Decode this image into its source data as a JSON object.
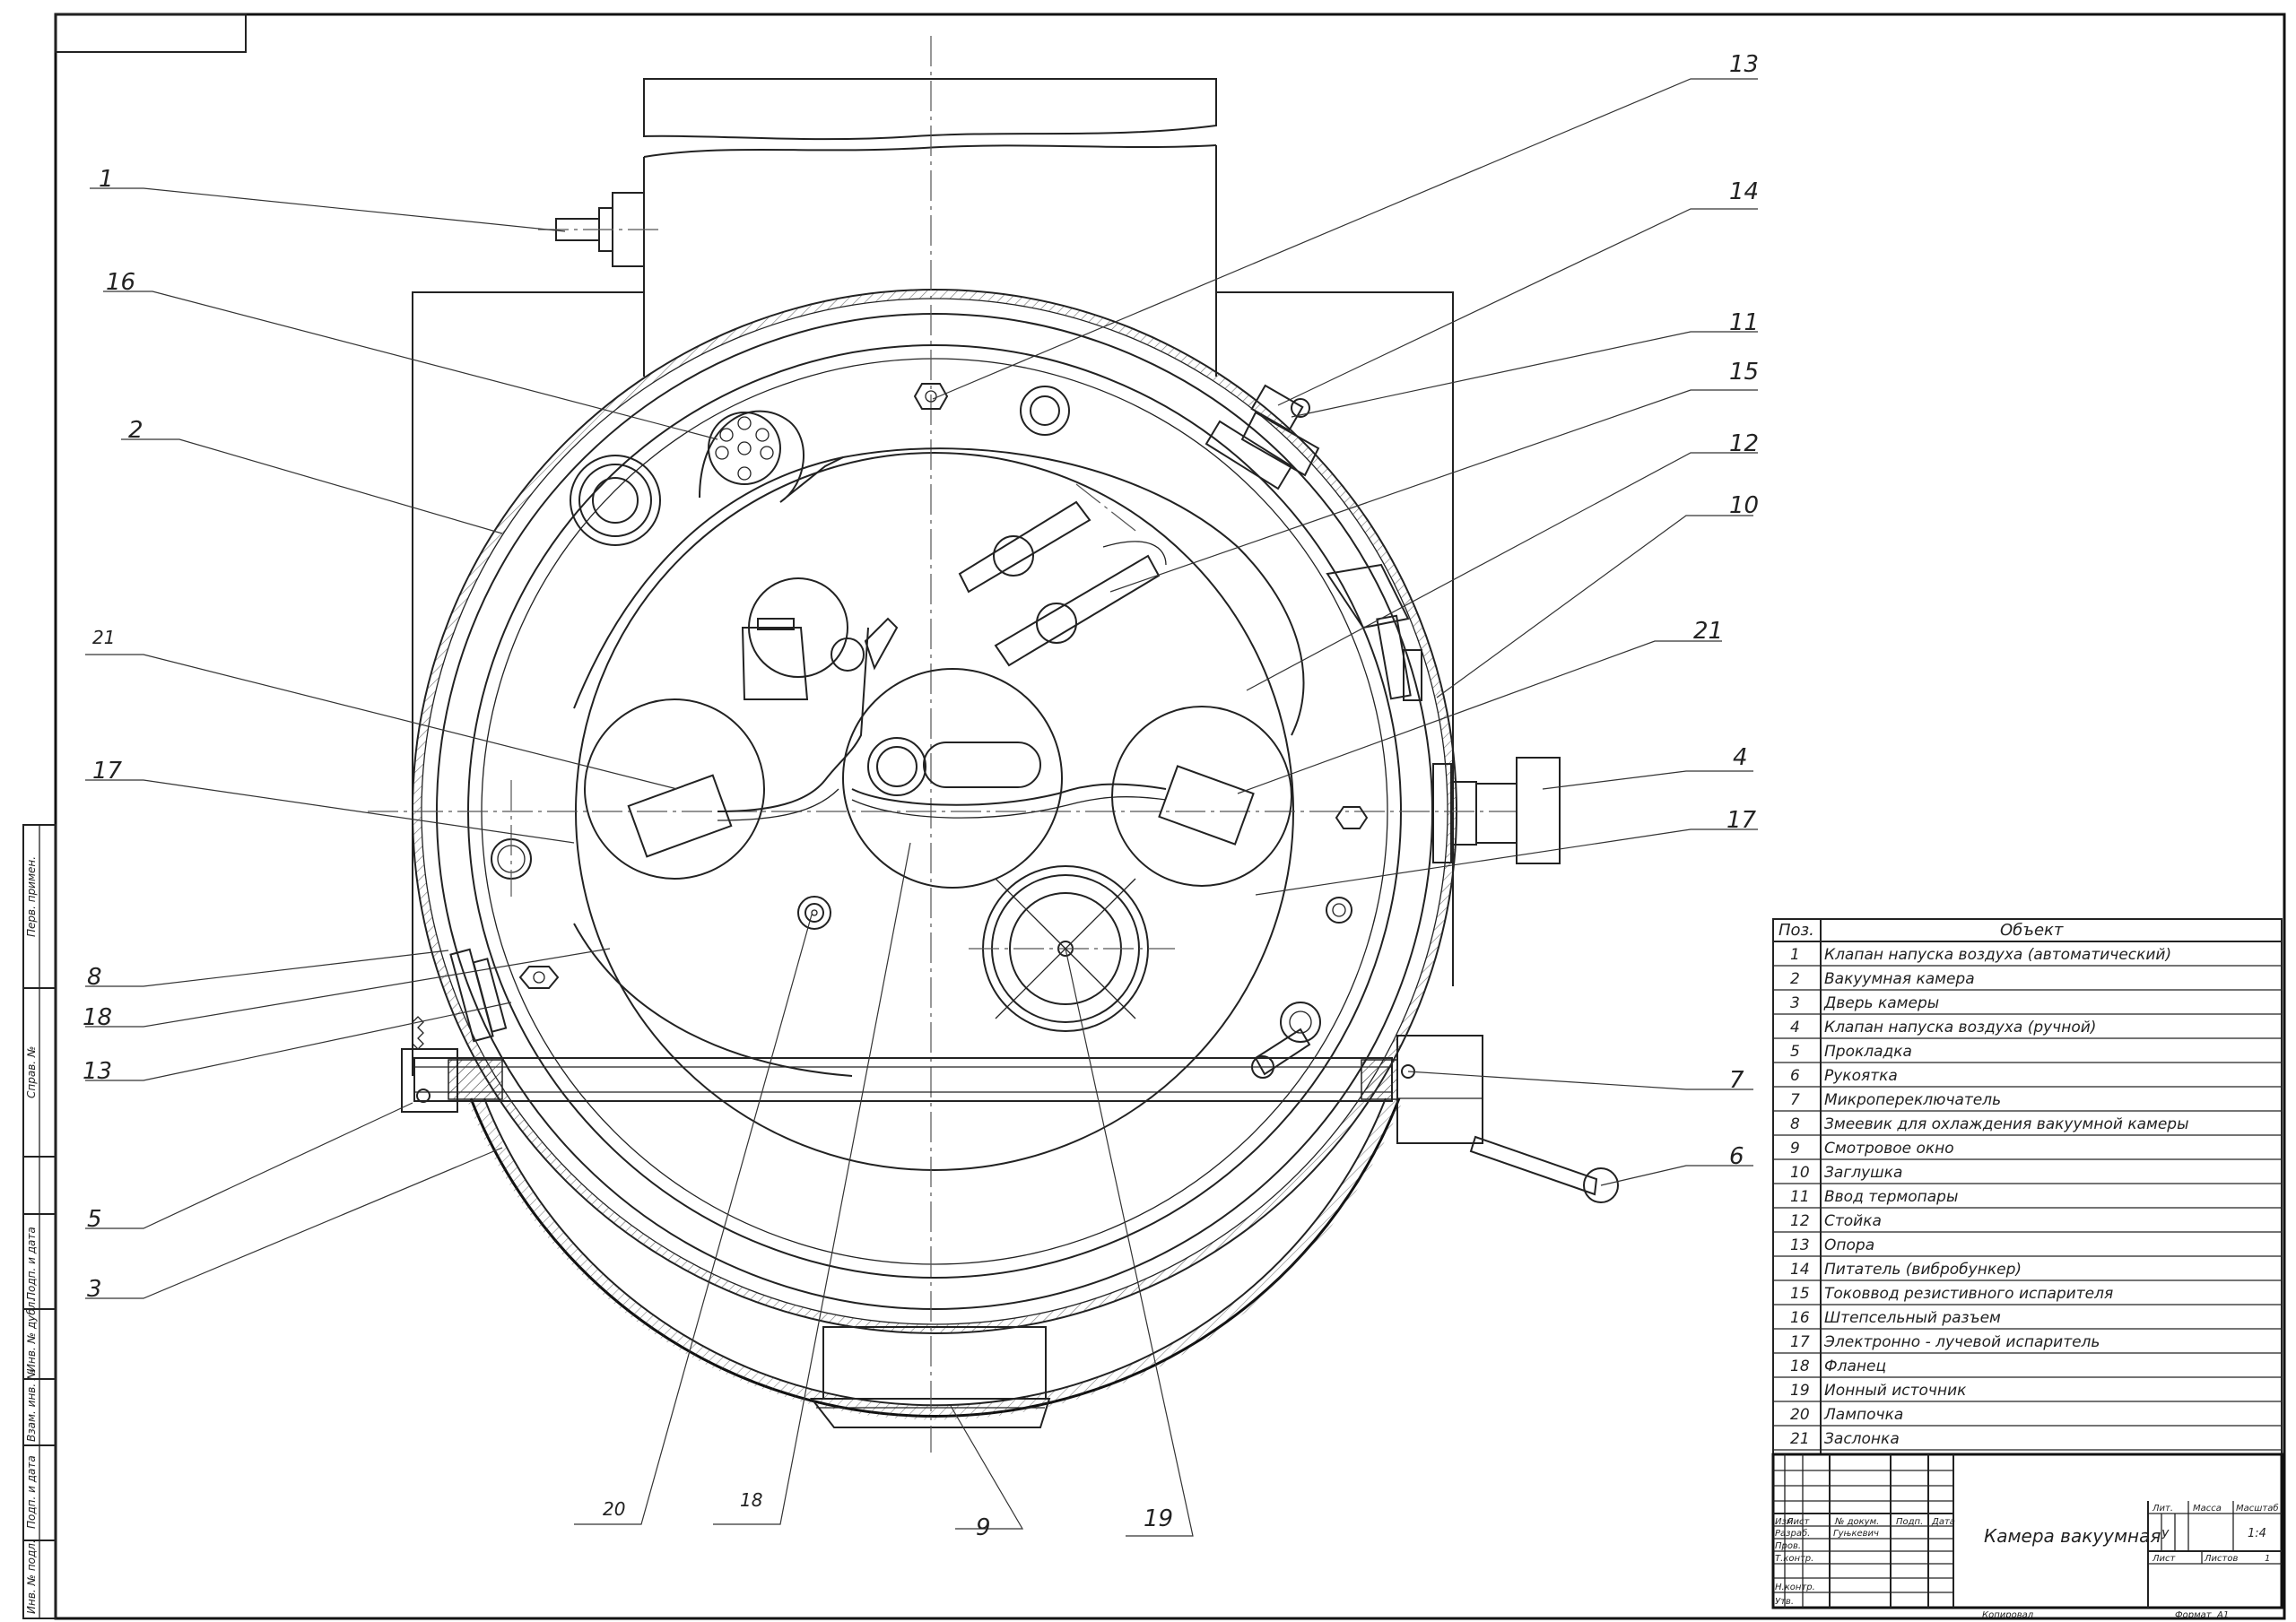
{
  "drawing": {
    "callouts": [
      {
        "label": "1"
      },
      {
        "label": "16"
      },
      {
        "label": "2"
      },
      {
        "label": "21"
      },
      {
        "label": "17"
      },
      {
        "label": "8"
      },
      {
        "label": "18"
      },
      {
        "label": "13"
      },
      {
        "label": "5"
      },
      {
        "label": "3"
      },
      {
        "label": "20"
      },
      {
        "label": "18"
      },
      {
        "label": "9"
      },
      {
        "label": "19"
      },
      {
        "label": "6"
      },
      {
        "label": "7"
      },
      {
        "label": "17"
      },
      {
        "label": "4"
      },
      {
        "label": "21"
      },
      {
        "label": "10"
      },
      {
        "label": "12"
      },
      {
        "label": "15"
      },
      {
        "label": "11"
      },
      {
        "label": "14"
      },
      {
        "label": "13"
      }
    ]
  },
  "parts_table": {
    "header_pos": "Поз.",
    "header_object": "Объект",
    "rows": [
      {
        "pos": "1",
        "name": "Клапан напуска воздуха (автоматический)"
      },
      {
        "pos": "2",
        "name": "Вакуумная камера"
      },
      {
        "pos": "3",
        "name": "Дверь камеры"
      },
      {
        "pos": "4",
        "name": "Клапан напуска воздуха (ручной)"
      },
      {
        "pos": "5",
        "name": "Прокладка"
      },
      {
        "pos": "6",
        "name": "Рукоятка"
      },
      {
        "pos": "7",
        "name": "Микропереключатель"
      },
      {
        "pos": "8",
        "name": "Змеевик для охлаждения вакуумной камеры"
      },
      {
        "pos": "9",
        "name": "Смотровое окно"
      },
      {
        "pos": "10",
        "name": "Заглушка"
      },
      {
        "pos": "11",
        "name": "Ввод термопары"
      },
      {
        "pos": "12",
        "name": "Стойка"
      },
      {
        "pos": "13",
        "name": "Опора"
      },
      {
        "pos": "14",
        "name": "Питатель (вибробункер)"
      },
      {
        "pos": "15",
        "name": "Токоввод резистивного испарителя"
      },
      {
        "pos": "16",
        "name": "Штепсельный разъем"
      },
      {
        "pos": "17",
        "name": "Электронно - лучевой испаритель"
      },
      {
        "pos": "18",
        "name": "Фланец"
      },
      {
        "pos": "19",
        "name": "Ионный источник"
      },
      {
        "pos": "20",
        "name": "Лампочка"
      },
      {
        "pos": "21",
        "name": "Заслонка"
      }
    ]
  },
  "title_block": {
    "izm": "Изм.",
    "list": "Лист",
    "doc_no": "№ докум.",
    "sign": "Подп.",
    "date": "Дата",
    "razrab": "Разраб.",
    "razrab_name": "Гуњкевич",
    "prov": "Пров.",
    "tkontr": "Т.контр.",
    "nkontr": "Н.контр.",
    "utv": "Утв.",
    "title": "Камера вакуумная",
    "lit": "Лит.",
    "massa": "Масса",
    "masshtab": "Масштаб",
    "lit_value": "У",
    "scale_value": "1:4",
    "sheet": "Лист",
    "sheets": "Листов",
    "sheets_value": "1",
    "copied": "Копировал",
    "format": "Формат",
    "format_value": "А1"
  },
  "side_stamp": {
    "perv_primen": "Перв. примен.",
    "sprav_no": "Справ. №",
    "podp_data_1": "Подп. и дата",
    "inv_dubl": "Инв. № дубл.",
    "vzam_inv": "Взам. инв. №",
    "podp_data_2": "Подп. и дата",
    "inv_podl": "Инв. № подл."
  }
}
